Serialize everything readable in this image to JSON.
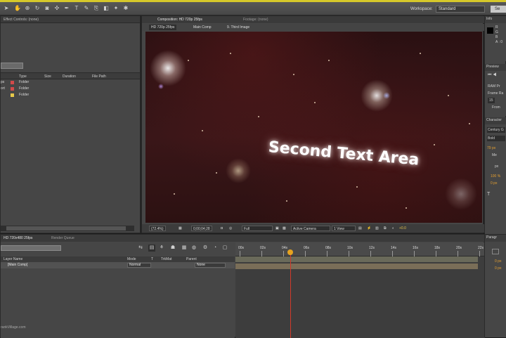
{
  "toolbar": {
    "tools": [
      "arrow-tool",
      "hand-tool",
      "zoom-tool",
      "rotate-tool",
      "camera-tool",
      "pan-tool",
      "pen-tool",
      "text-tool",
      "brush-tool",
      "clone-tool",
      "eraser-tool",
      "roto-tool",
      "puppet-tool"
    ],
    "workspace_label": "Workspace:",
    "workspace_value": "Standard",
    "search_value": "Se"
  },
  "project": {
    "tab_label": "Effect Controls: (none)",
    "columns": [
      "Type",
      "Size",
      "Duration",
      "File Path"
    ],
    "rows": [
      {
        "prefix": "ps",
        "type": "Folder",
        "color": "#d24a4a"
      },
      {
        "prefix": "ort",
        "type": "Folder",
        "color": "#d24a4a"
      },
      {
        "prefix": "",
        "type": "Folder",
        "color": "#e6c84a"
      }
    ]
  },
  "composition": {
    "tab_label": "Composition: HD 720p 25fps",
    "footage_tab": "Footage: (none)",
    "breadcrumbs": [
      "HD 720p 25fps",
      "Main Comp",
      "9. Third Image"
    ],
    "viewer_text": "Second Text Area",
    "footer": {
      "zoom": "(72.4%)",
      "timecode": "0;00;04;28",
      "resolution": "Full",
      "camera": "Active Camera",
      "views": "1 View",
      "exposure": "+0.0"
    }
  },
  "right_panel": {
    "info_tab": "Info",
    "info_lines": [
      "R",
      "G",
      "B",
      "A : 0"
    ],
    "preview_tab": "Preview",
    "preview_lines": [
      "RAM Pr",
      "Frame Ra",
      "15",
      "From"
    ],
    "character_tab": "Character",
    "character_lines": [
      "Century G",
      "Bold",
      "79 px",
      "Me",
      "px",
      "100 %",
      "0 px"
    ],
    "paragraph_tab": "Paragr",
    "paragraph_lines": [
      "0 px",
      "0 px"
    ]
  },
  "timeline": {
    "tab_label": "HD 720x480 25fps",
    "render_tab": "Render Queue",
    "columns": [
      "Layer Name",
      "Mode",
      "T",
      "TrkMat",
      "Parent"
    ],
    "layer": {
      "name": "[Main Comp]",
      "mode": "Normal",
      "parent": "None"
    },
    "ruler_labels": [
      "00s",
      "02s",
      "04s",
      "06s",
      "08s",
      "10s",
      "12s",
      "14s",
      "16s",
      "18s",
      "20s",
      "22s"
    ],
    "playhead_time_seconds": 4.97,
    "watermark": "rankVillage.com"
  }
}
